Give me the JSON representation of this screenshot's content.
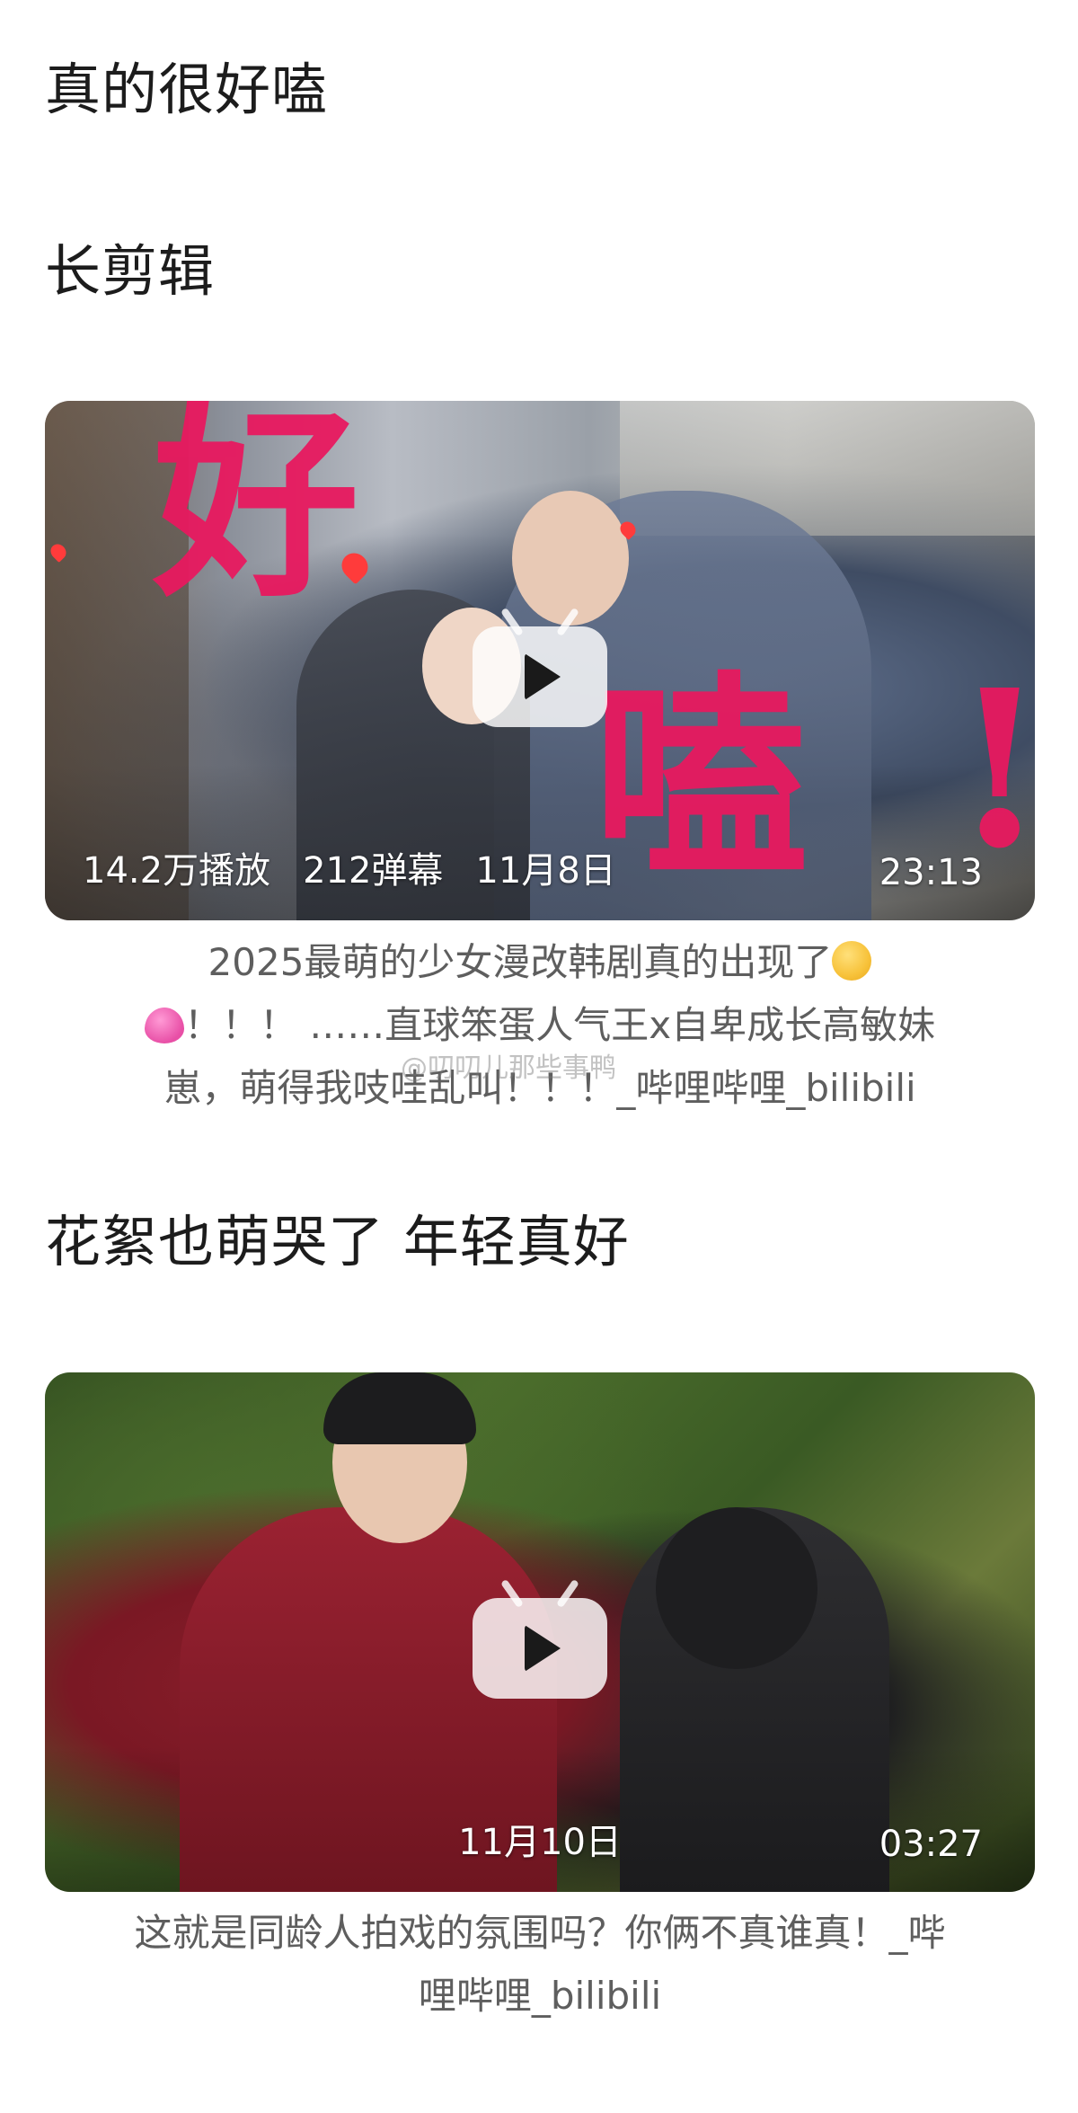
{
  "page": {
    "title": "真的很好嗑",
    "watermark": "@叨叨儿那些事鸭"
  },
  "sections": [
    {
      "heading": "长剪辑",
      "video": {
        "thumbnail_text_top": "好",
        "thumbnail_text_bottom": "嗑",
        "thumbnail_text_exclaim": "!",
        "views": "14.2万播放",
        "danmaku": "212弹幕",
        "date": "11月8日",
        "duration": "23:13",
        "caption_line1": "2025最萌的少女漫改韩剧真的出现了",
        "caption_line2": "！！！ ……直球笨蛋人气王x自卑成长高敏妹",
        "caption_line3": "崽，萌得我吱哇乱叫！！！_哔哩哔哩_bilibili",
        "caption_emoji_1": "pleading-face-emoji",
        "caption_emoji_2": "pink-heart-emoji"
      }
    },
    {
      "heading": "花絮也萌哭了 年轻真好",
      "video": {
        "date": "11月10日",
        "duration": "03:27",
        "caption_line1": "这就是同龄人拍戏的氛围吗？你俩不真谁真！_哔",
        "caption_line2": "哩哔哩_bilibili"
      }
    }
  ],
  "colors": {
    "accent_pink": "#e8195f",
    "caption_gray": "#5e5e5e",
    "text_dark": "#1c1c1c"
  }
}
